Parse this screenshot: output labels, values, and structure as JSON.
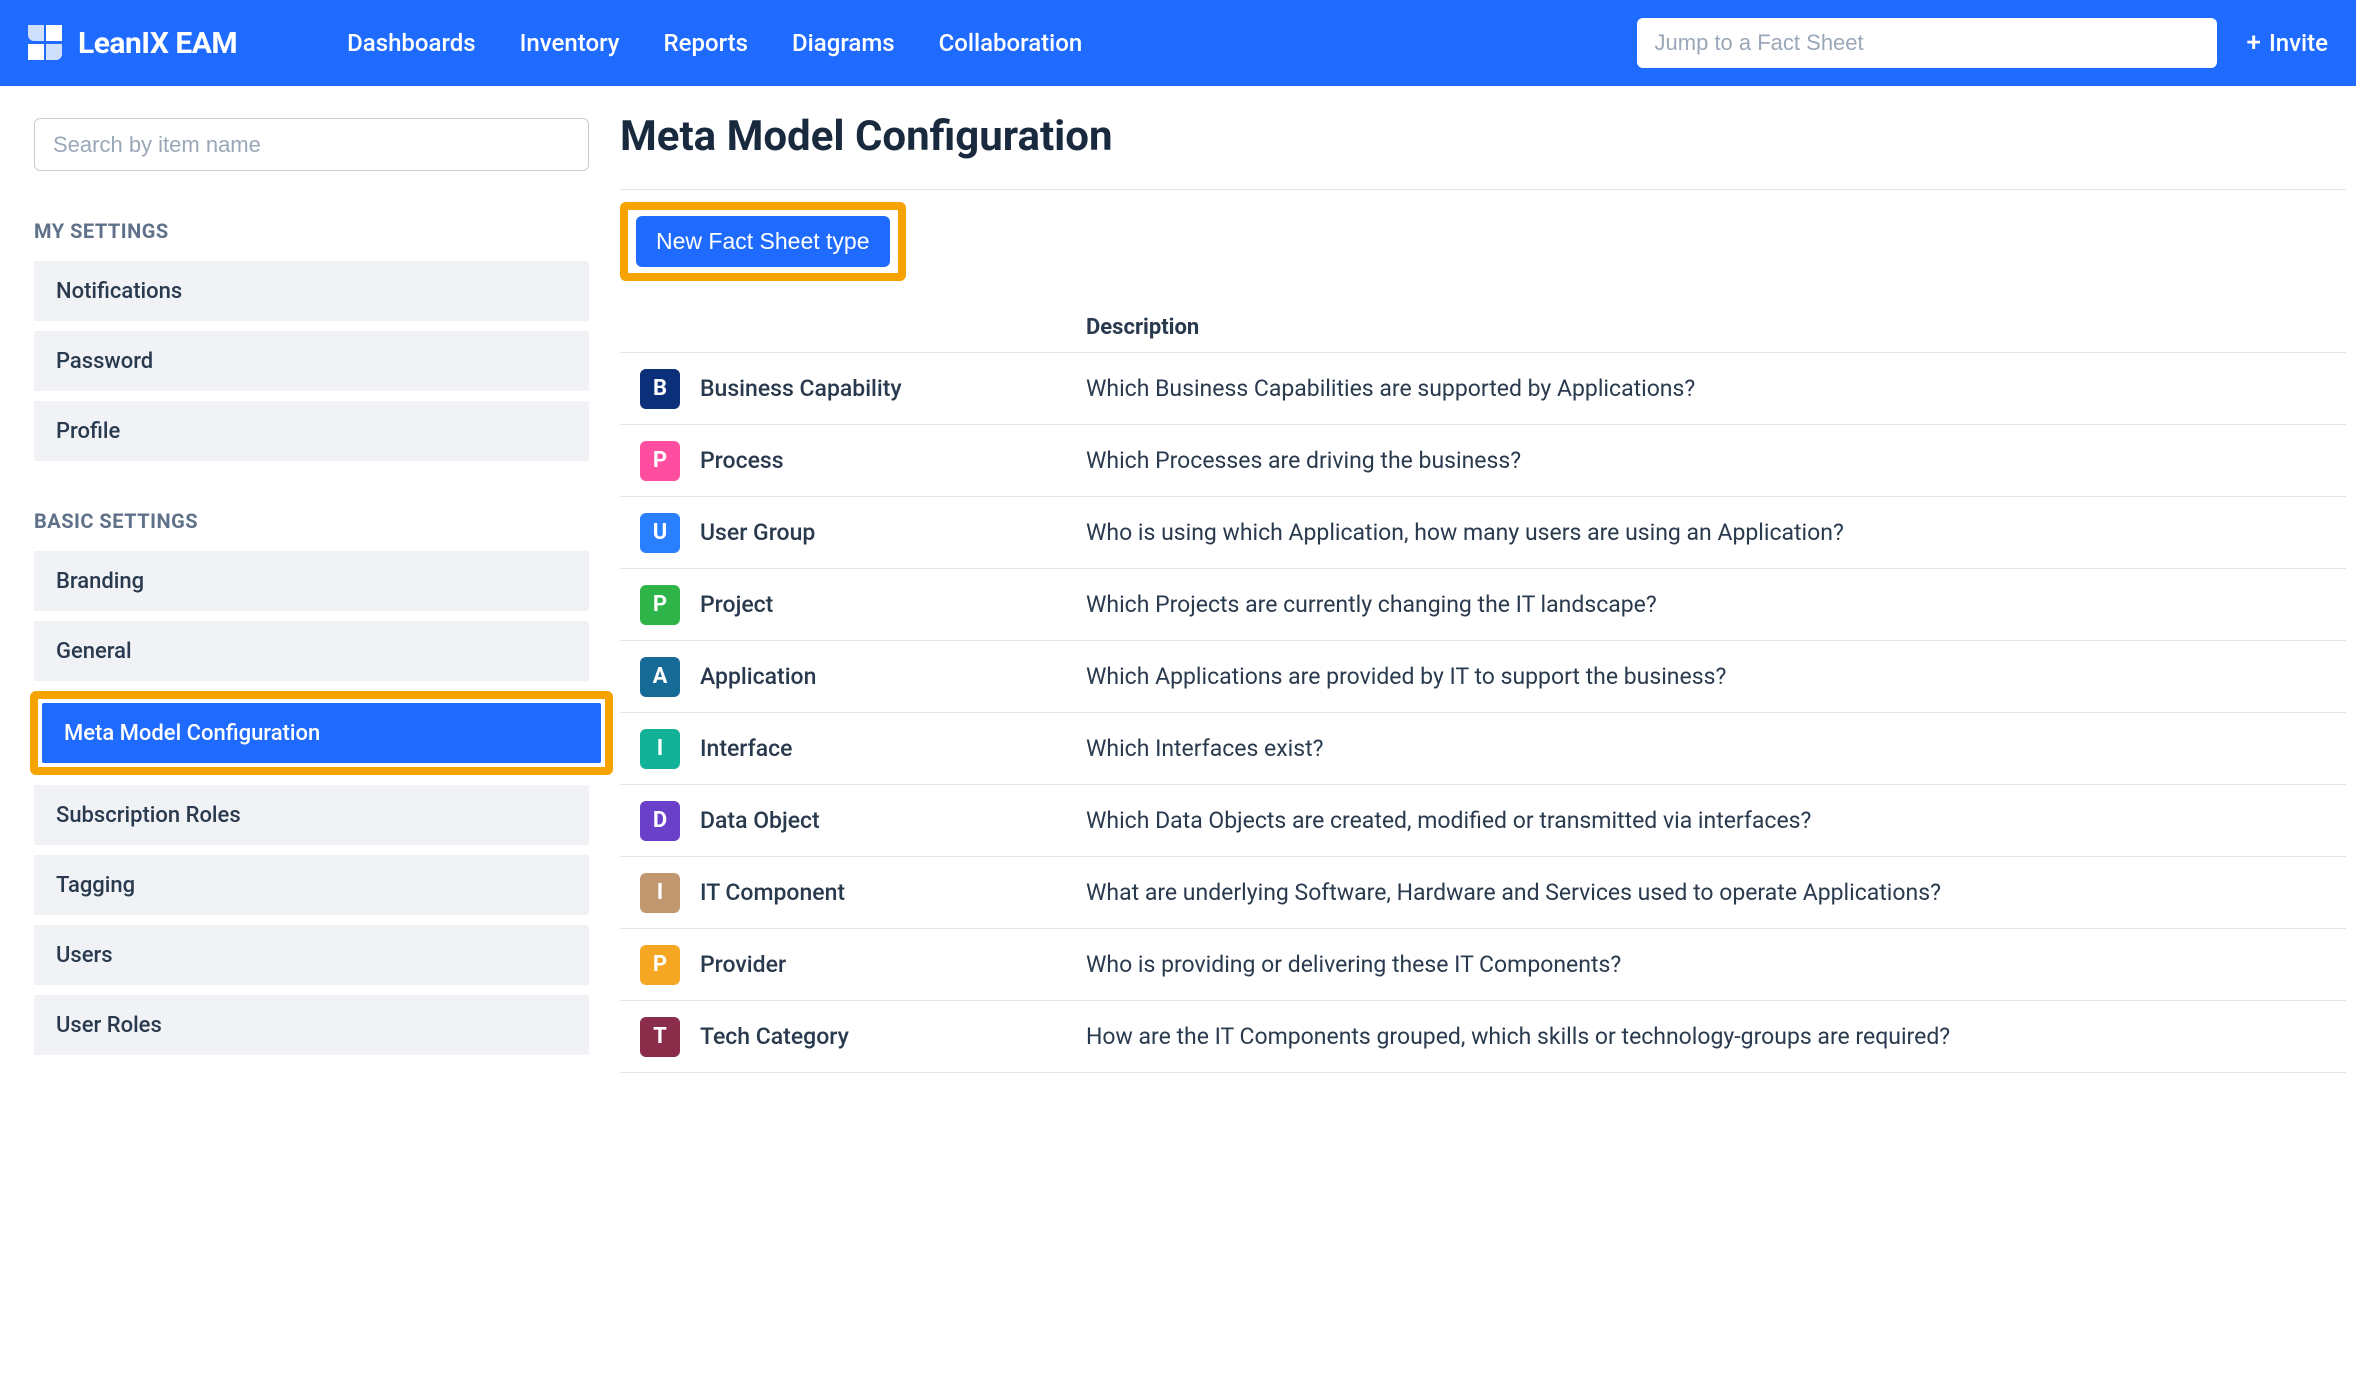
{
  "brand": "LeanIX EAM",
  "topnav": [
    "Dashboards",
    "Inventory",
    "Reports",
    "Diagrams",
    "Collaboration"
  ],
  "fact_search_placeholder": "Jump to a Fact Sheet",
  "invite_label": "Invite",
  "sidebar": {
    "search_placeholder": "Search by item name",
    "group1_title": "MY SETTINGS",
    "group1_items": [
      "Notifications",
      "Password",
      "Profile"
    ],
    "group2_title": "BASIC SETTINGS",
    "group2_items": [
      "Branding",
      "General",
      "Meta Model Configuration",
      "Subscription Roles",
      "Tagging",
      "Users",
      "User Roles"
    ],
    "active_index": 2
  },
  "page": {
    "title": "Meta Model Configuration",
    "new_button": "New Fact Sheet type",
    "col_desc": "Description",
    "rows": [
      {
        "letter": "B",
        "color": "#0c2f7a",
        "name": "Business Capability",
        "desc": "Which Business Capabilities are supported by Applications?"
      },
      {
        "letter": "P",
        "color": "#ff4da0",
        "name": "Process",
        "desc": "Which Processes are driving the business?"
      },
      {
        "letter": "U",
        "color": "#2a7fff",
        "name": "User Group",
        "desc": "Who is using which Application, how many users are using an Application?"
      },
      {
        "letter": "P",
        "color": "#2fb44a",
        "name": "Project",
        "desc": "Which Projects are currently changing the IT landscape?"
      },
      {
        "letter": "A",
        "color": "#156a96",
        "name": "Application",
        "desc": "Which Applications are provided by IT to support the business?"
      },
      {
        "letter": "I",
        "color": "#11b297",
        "name": "Interface",
        "desc": "Which Interfaces exist?"
      },
      {
        "letter": "D",
        "color": "#6a3fc9",
        "name": "Data Object",
        "desc": "Which Data Objects are created, modified or transmitted via interfaces?"
      },
      {
        "letter": "I",
        "color": "#c19770",
        "name": "IT Component",
        "desc": "What are underlying Software, Hardware and Services used to operate Applications?"
      },
      {
        "letter": "P",
        "color": "#f5a623",
        "name": "Provider",
        "desc": "Who is providing or delivering these IT Components?"
      },
      {
        "letter": "T",
        "color": "#8a2d4b",
        "name": "Tech Category",
        "desc": "How are the IT Components grouped, which skills or technology-groups are required?"
      }
    ]
  }
}
